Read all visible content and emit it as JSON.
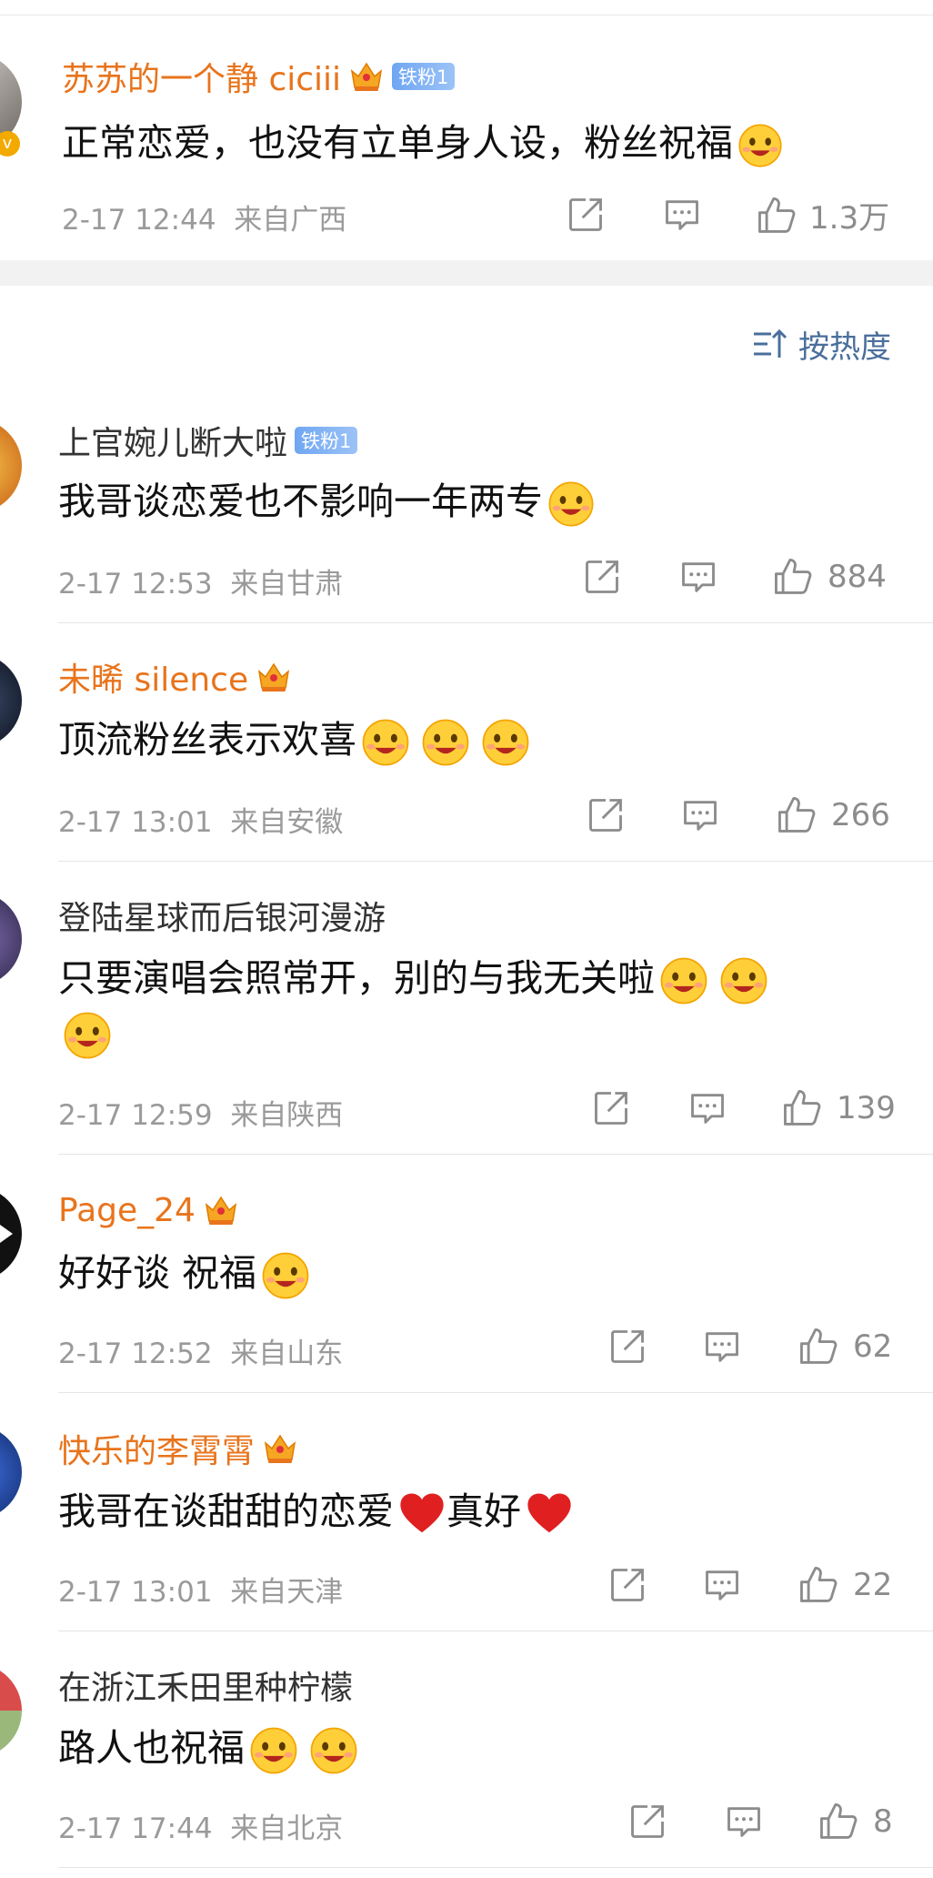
{
  "sort_label": "按热度",
  "pinned": {
    "username": "苏苏的一个静 ciciii",
    "badge": "铁粉1",
    "content": "正常恋爱，也没有立单身人设，粉丝祝福",
    "date": "2-17 12:44",
    "location": "来自广西",
    "likes": "1.3万"
  },
  "comments": [
    {
      "username": "上官婉儿断大啦",
      "badge": "铁粉1",
      "content": "我哥谈恋爱也不影响一年两专",
      "date": "2-17 12:53",
      "location": "来自甘肃",
      "likes": "884"
    },
    {
      "username": "未晞 silence",
      "content": "顶流粉丝表示欢喜",
      "date": "2-17 13:01",
      "location": "来自安徽",
      "likes": "266"
    },
    {
      "username": "登陆星球而后银河漫游",
      "content": "只要演唱会照常开，别的与我无关啦",
      "date": "2-17 12:59",
      "location": "来自陕西",
      "likes": "139"
    },
    {
      "username": "Page_24",
      "content": "好好谈 祝福",
      "date": "2-17 12:52",
      "location": "来自山东",
      "likes": "62"
    },
    {
      "username": "快乐的李霄霄",
      "content_a": "我哥在谈甜甜的恋爱",
      "content_b": "真好",
      "date": "2-17 13:01",
      "location": "来自天津",
      "likes": "22"
    },
    {
      "username": "在浙江禾田里种柠檬",
      "content": "路人也祝福",
      "date": "2-17 17:44",
      "location": "来自北京",
      "likes": "8"
    }
  ],
  "colors": {
    "orange_name": "#e8741c",
    "link_blue": "#4a6f9c",
    "heart_red": "#e02020"
  }
}
